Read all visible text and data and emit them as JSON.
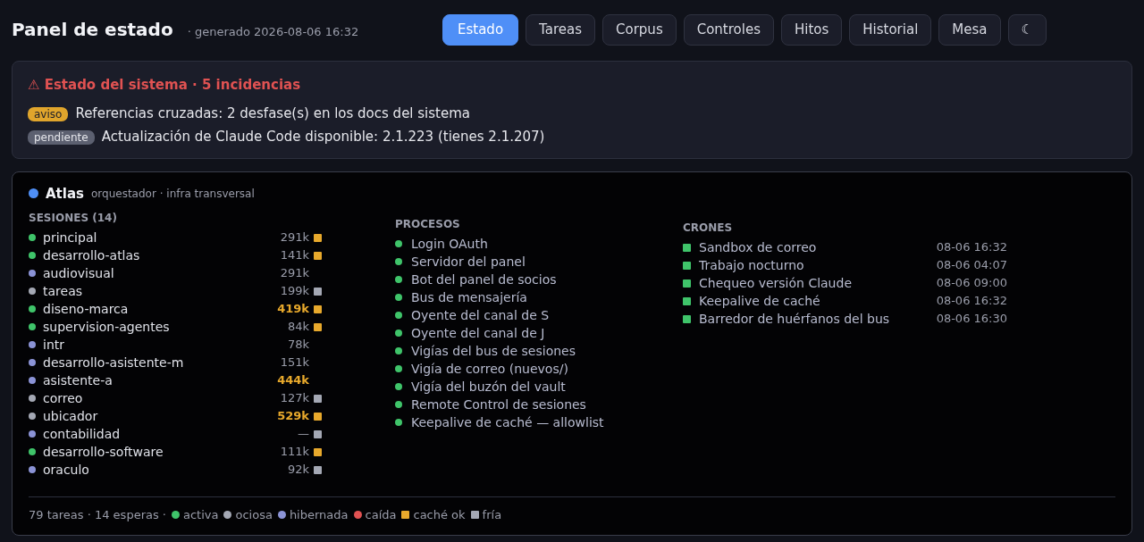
{
  "header": {
    "title": "Panel de estado",
    "subtitle": "· generado 2026-08-06 16:32"
  },
  "tabs": [
    {
      "label": "Estado",
      "selected": true
    },
    {
      "label": "Tareas",
      "selected": false
    },
    {
      "label": "Corpus",
      "selected": false
    },
    {
      "label": "Controles",
      "selected": false
    },
    {
      "label": "Hitos",
      "selected": false
    },
    {
      "label": "Historial",
      "selected": false
    },
    {
      "label": "Mesa",
      "selected": false
    },
    {
      "label": "☾",
      "selected": false
    }
  ],
  "alerts": {
    "title": "⚠ Estado del sistema · 5 incidencias",
    "items": [
      {
        "badge": "aviso",
        "kind": "warning",
        "text": "Referencias cruzadas: 2 desfase(s) en los docs del sistema"
      },
      {
        "badge": "pendiente",
        "kind": "pending",
        "text": "Actualización de Claude Code disponible: 2.1.223 (tienes 2.1.207)"
      }
    ]
  },
  "agent": {
    "name": "Atlas",
    "color": "#4f8ff7",
    "role": "orquestador · infra transversal",
    "sessions": {
      "heading": "SESIONES (14)",
      "items": [
        {
          "name": "principal",
          "color": "#3fc46a",
          "tokens": "291k",
          "high": false,
          "cache": {
            "color": "#e8a92c"
          }
        },
        {
          "name": "desarrollo-atlas",
          "color": "#3fc46a",
          "tokens": "141k",
          "high": false,
          "cache": {
            "color": "#e8a92c"
          }
        },
        {
          "name": "audiovisual",
          "color": "#8b93d6",
          "tokens": "291k",
          "high": false
        },
        {
          "name": "tareas",
          "color": "#a4a8b4",
          "tokens": "199k",
          "high": false,
          "cache": {
            "color": "#a4a8b4"
          }
        },
        {
          "name": "diseno-marca",
          "color": "#3fc46a",
          "tokens": "419k",
          "high": true,
          "cache": {
            "color": "#e8a92c"
          }
        },
        {
          "name": "supervision-agentes",
          "color": "#3fc46a",
          "tokens": "84k",
          "high": false,
          "cache": {
            "color": "#e8a92c"
          }
        },
        {
          "name": "intr",
          "color": "#8b93d6",
          "tokens": "78k",
          "high": false
        },
        {
          "name": "desarrollo-asistente-m",
          "color": "#8b93d6",
          "tokens": "151k",
          "high": false
        },
        {
          "name": "asistente-a",
          "color": "#8b93d6",
          "tokens": "444k",
          "high": true
        },
        {
          "name": "correo",
          "color": "#a4a8b4",
          "tokens": "127k",
          "high": false,
          "cache": {
            "color": "#a4a8b4"
          }
        },
        {
          "name": "ubicador",
          "color": "#a4a8b4",
          "tokens": "529k",
          "high": true,
          "cache": {
            "color": "#e8a92c"
          }
        },
        {
          "name": "contabilidad",
          "color": "#8b93d6",
          "tokens": "—",
          "high": false,
          "cache": {
            "color": "#a4a8b4"
          }
        },
        {
          "name": "desarrollo-software",
          "color": "#3fc46a",
          "tokens": "111k",
          "high": false,
          "cache": {
            "color": "#e8a92c"
          }
        },
        {
          "name": "oraculo",
          "color": "#8b93d6",
          "tokens": "92k",
          "high": false,
          "cache": {
            "color": "#a4a8b4"
          }
        }
      ]
    },
    "processes": {
      "heading": "PROCESOS",
      "items": [
        {
          "name": "Login OAuth",
          "color": "#3fc46a"
        },
        {
          "name": "Servidor del panel",
          "color": "#3fc46a"
        },
        {
          "name": "Bot del panel de socios",
          "color": "#3fc46a"
        },
        {
          "name": "Bus de mensajería",
          "color": "#3fc46a"
        },
        {
          "name": "Oyente del canal de S",
          "color": "#3fc46a"
        },
        {
          "name": "Oyente del canal de J",
          "color": "#3fc46a"
        },
        {
          "name": "Vigías del bus de sesiones",
          "color": "#3fc46a"
        },
        {
          "name": "Vigía de correo (nuevos/)",
          "color": "#3fc46a"
        },
        {
          "name": "Vigía del buzón del vault",
          "color": "#3fc46a"
        },
        {
          "name": "Remote Control de sesiones",
          "color": "#3fc46a"
        },
        {
          "name": "Keepalive de caché — allowlist",
          "color": "#3fc46a"
        }
      ]
    },
    "crons": {
      "heading": "CRONES",
      "items": [
        {
          "name": "Sandbox de correo",
          "color": "#3fc46a",
          "time": "08-06 16:32"
        },
        {
          "name": "Trabajo nocturno",
          "color": "#3fc46a",
          "time": "08-06 04:07"
        },
        {
          "name": "Chequeo versión Claude",
          "color": "#3fc46a",
          "time": "08-06 09:00"
        },
        {
          "name": "Keepalive de caché",
          "color": "#3fc46a",
          "time": "08-06 16:32"
        },
        {
          "name": "Barredor de huérfanos del bus",
          "color": "#3fc46a",
          "time": "08-06 16:30"
        }
      ]
    }
  },
  "footer": {
    "summary": "79 tareas · 14 esperas ·",
    "legend": [
      {
        "label": "activa",
        "color": "#3fc46a",
        "kind": "dot"
      },
      {
        "label": "ociosa",
        "color": "#a4a8b4",
        "kind": "dot"
      },
      {
        "label": "hibernada",
        "color": "#8b93d6",
        "kind": "dot"
      },
      {
        "label": "caída",
        "color": "#e05252",
        "kind": "dot"
      },
      {
        "label": "caché ok",
        "color": "#e8a92c",
        "kind": "square"
      },
      {
        "label": "fría",
        "color": "#a4a8b4",
        "kind": "square"
      }
    ]
  }
}
